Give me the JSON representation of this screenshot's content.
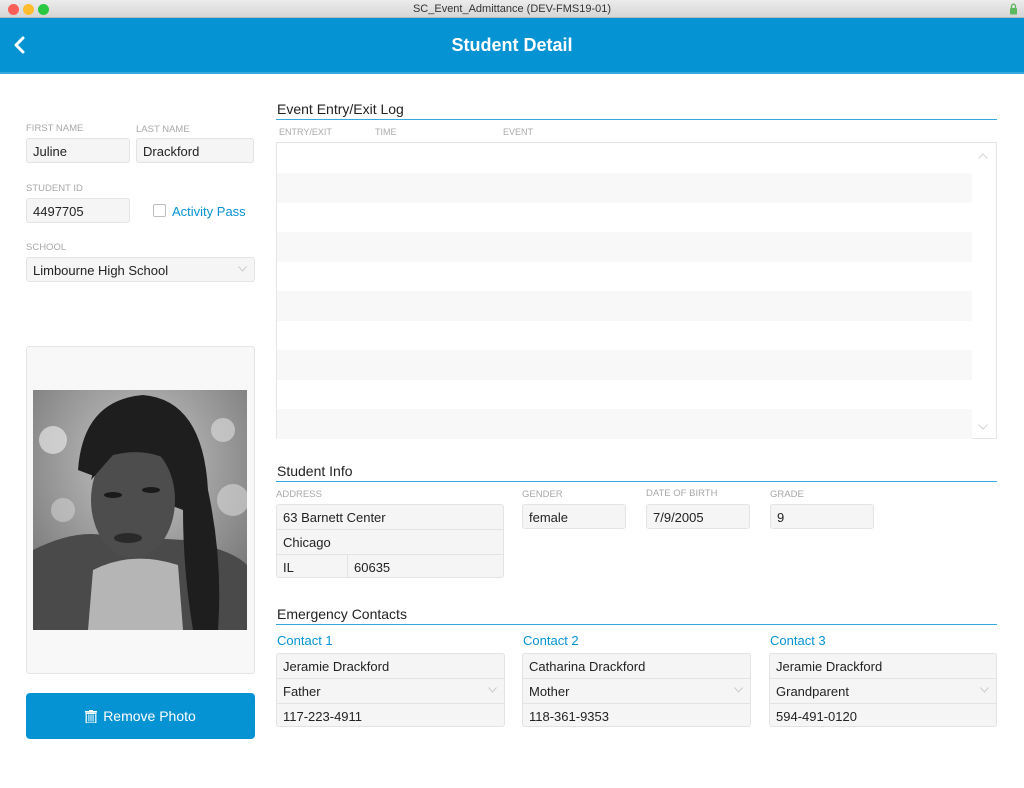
{
  "window": {
    "title": "SC_Event_Admittance (DEV-FMS19-01)"
  },
  "header": {
    "title": "Student Detail",
    "back_icon": "chevron-left-icon"
  },
  "student": {
    "first_name_label": "FIRST NAME",
    "first_name": "Juline",
    "last_name_label": "LAST NAME",
    "last_name": "Drackford",
    "student_id_label": "STUDENT ID",
    "student_id": "4497705",
    "activity_pass_label": "Activity Pass",
    "activity_pass_checked": false,
    "school_label": "SCHOOL",
    "school": "Limbourne High School"
  },
  "photo": {
    "remove_label": "Remove Photo",
    "remove_icon": "trash-icon"
  },
  "log": {
    "title": "Event Entry/Exit Log",
    "columns": [
      "ENTRY/EXIT",
      "TIME",
      "EVENT"
    ],
    "rows": []
  },
  "info": {
    "title": "Student Info",
    "address_label": "ADDRESS",
    "street": "63 Barnett Center",
    "city": "Chicago",
    "state": "IL",
    "zip": "60635",
    "gender_label": "GENDER",
    "gender": "female",
    "dob_label": "DATE OF BIRTH",
    "dob": "7/9/2005",
    "grade_label": "GRADE",
    "grade": "9"
  },
  "contacts": {
    "title": "Emergency Contacts",
    "items": [
      {
        "label": "Contact 1",
        "name": "Jeramie Drackford",
        "relation": "Father",
        "phone": "117-223-4911"
      },
      {
        "label": "Contact 2",
        "name": "Catharina Drackford",
        "relation": "Mother",
        "phone": "118-361-9353"
      },
      {
        "label": "Contact 3",
        "name": "Jeramie Drackford",
        "relation": "Grandparent",
        "phone": "594-491-0120"
      }
    ]
  },
  "colors": {
    "accent": "#0693d3",
    "field_bg": "#f5f5f5",
    "label": "#a8a8a8"
  }
}
